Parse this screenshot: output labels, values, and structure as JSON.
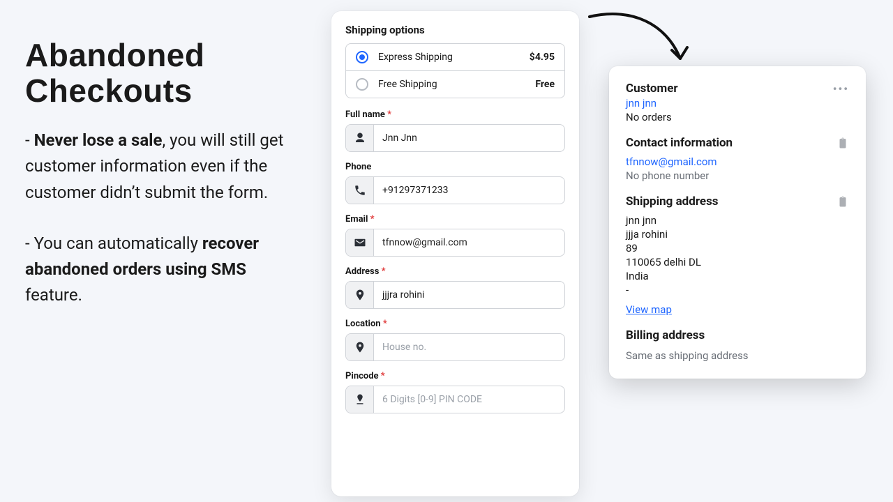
{
  "promo": {
    "title": "Abandoned Checkouts",
    "p1_lead": "- ",
    "p1_bold": "Never lose a sale",
    "p1_tail": ", you will still get customer information even if the customer didn’t submit the form.",
    "p2_lead": "- You can automatically ",
    "p2_bold": "recover abandoned orders using SMS",
    "p2_tail": " feature."
  },
  "checkout": {
    "shipping_title": "Shipping options",
    "options": [
      {
        "label": "Express Shipping",
        "price": "$4.95",
        "selected": true
      },
      {
        "label": "Free Shipping",
        "price": "Free",
        "selected": false
      }
    ],
    "fields": {
      "full_name": {
        "label": "Full name",
        "required": true,
        "value": "Jnn Jnn"
      },
      "phone": {
        "label": "Phone",
        "required": false,
        "value": "+91297371233"
      },
      "email": {
        "label": "Email",
        "required": true,
        "value": "tfnnow@gmail.com"
      },
      "address": {
        "label": "Address",
        "required": true,
        "value": "jjjra rohini"
      },
      "location": {
        "label": "Location",
        "required": true,
        "placeholder": "House no."
      },
      "pincode": {
        "label": "Pincode",
        "required": true,
        "placeholder": "6 Digits [0-9] PIN CODE"
      }
    }
  },
  "customer": {
    "heading": "Customer",
    "name": "jnn jnn",
    "orders": "No orders",
    "contact_heading": "Contact information",
    "email": "tfnnow@gmail.com",
    "phone_note": "No phone number",
    "shipping_heading": "Shipping address",
    "shipping_lines": [
      "jnn jnn",
      "jjja rohini",
      "89",
      "110065 delhi DL",
      "India",
      "-"
    ],
    "view_map": "View map",
    "billing_heading": "Billing address",
    "billing_note": "Same as shipping address"
  }
}
